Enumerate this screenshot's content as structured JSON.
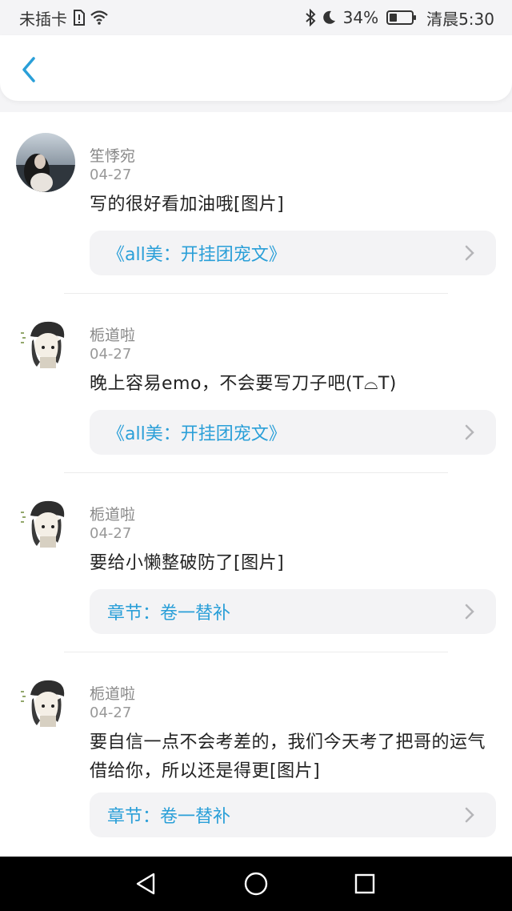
{
  "status_bar": {
    "carrier": "未插卡",
    "battery_percent": "34%",
    "battery_level": 0.34,
    "time": "清晨5:30"
  },
  "header": {
    "back_icon": "chevron-left-icon",
    "accent_color": "#2a9fd8"
  },
  "comments": [
    {
      "name": "笙悸宛",
      "date": "04-27",
      "text": "写的很好看加油哦[图片]",
      "link": "《all美：开挂团宠文》",
      "avatar": "girl-photo-avatar"
    },
    {
      "name": "栀道啦",
      "date": "04-27",
      "text": "晚上容易emo，不会要写刀子吧(T⌓T)",
      "link": "《all美：开挂团宠文》",
      "avatar": "cartoon-avatar"
    },
    {
      "name": "栀道啦",
      "date": "04-27",
      "text": "要给小懒整破防了[图片]",
      "link": "章节：卷一替补",
      "avatar": "cartoon-avatar"
    },
    {
      "name": "栀道啦",
      "date": "04-27",
      "text": "要自信一点不会考差的，我们今天考了把哥的运气借给你，所以还是得更[图片]",
      "link": "章节：卷一替补",
      "avatar": "cartoon-avatar"
    }
  ],
  "nav_bar": {
    "back": "triangle-back-icon",
    "home": "circle-home-icon",
    "recents": "square-recents-icon"
  }
}
